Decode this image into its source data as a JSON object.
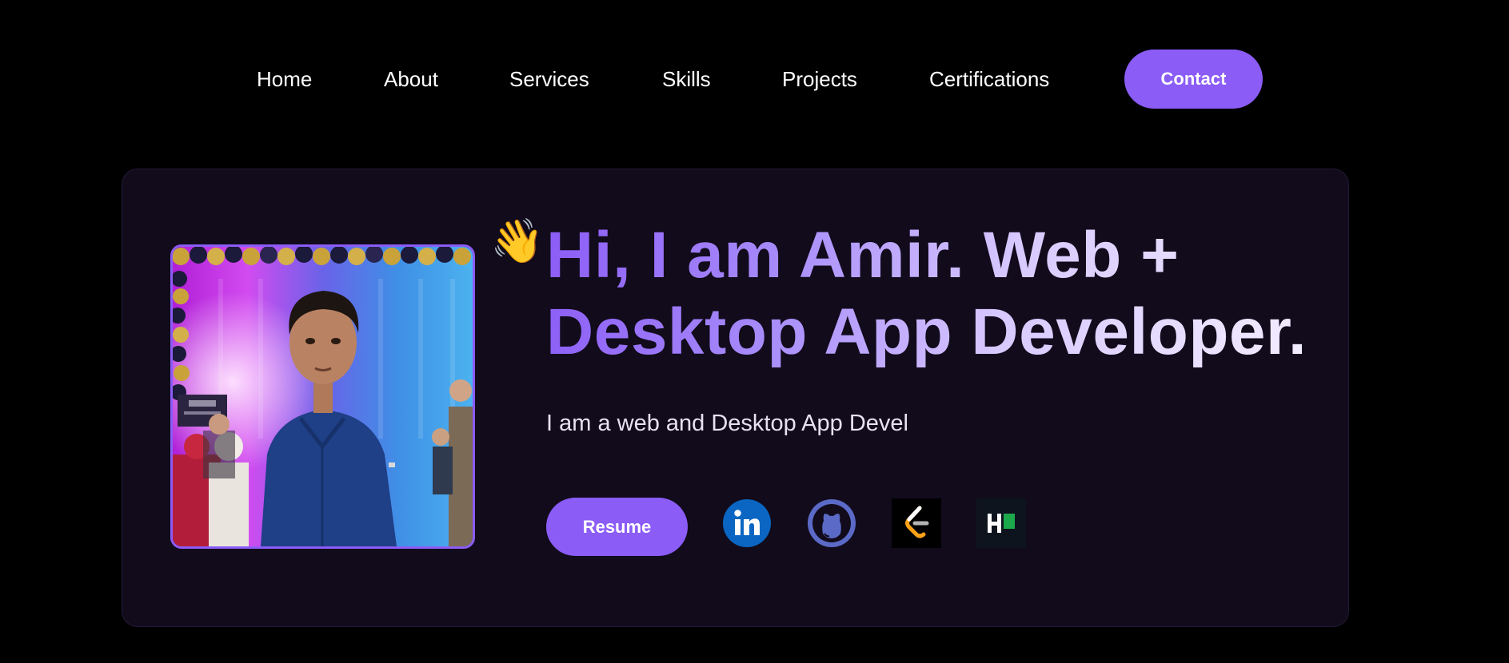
{
  "nav": {
    "items": [
      {
        "label": "Home"
      },
      {
        "label": "About"
      },
      {
        "label": "Services"
      },
      {
        "label": "Skills"
      },
      {
        "label": "Projects"
      },
      {
        "label": "Certifications"
      }
    ],
    "contact_label": "Contact"
  },
  "hero": {
    "wave_emoji": "👋",
    "headline_line1": "Hi, I am Amir. Web +",
    "headline_line2": "Desktop App Developer.",
    "tagline": "I am a web and Desktop App Devel",
    "resume_label": "Resume",
    "socials": [
      {
        "icon": "linkedin-icon",
        "color": "#0a66c2"
      },
      {
        "icon": "github-icon",
        "color": "#5b6ac6"
      },
      {
        "icon": "leetcode-icon",
        "color": "#ffa116"
      },
      {
        "icon": "hackerrank-icon",
        "color": "#1ba94c"
      }
    ]
  },
  "colors": {
    "accent": "#8b5cf6",
    "background": "#000000",
    "card": "#110b1c"
  }
}
